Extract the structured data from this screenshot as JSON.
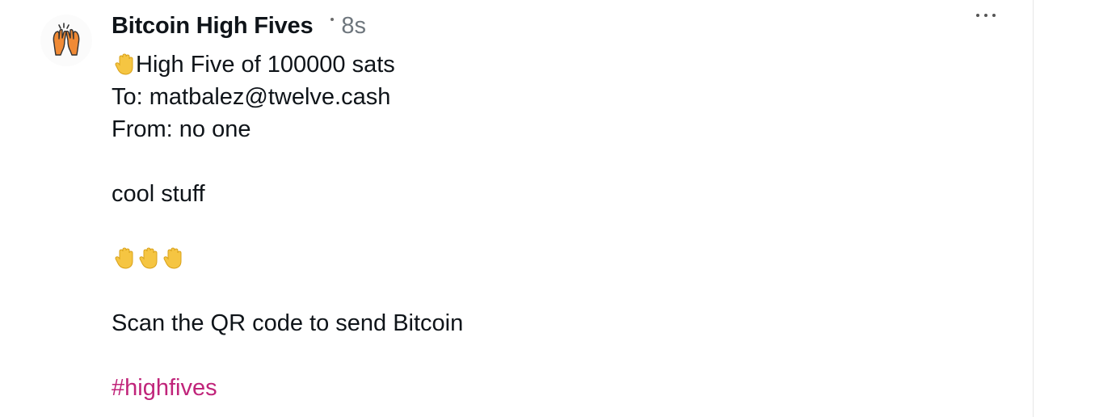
{
  "author": {
    "name": "Bitcoin High Fives",
    "timestamp": "8s",
    "avatar_icon": "high-five-hands-icon"
  },
  "post": {
    "line1": "High Five of 100000 sats",
    "line1_icon": "raised-hand-icon",
    "to": "To: matbalez@twelve.cash",
    "from": "From: no one",
    "message": "cool stuff",
    "hands_icons": [
      "raised-hand-icon",
      "raised-hand-icon",
      "raised-hand-icon"
    ],
    "cta": "Scan the QR code to send Bitcoin",
    "hashtag": "#highfives"
  },
  "menu": {
    "icon": "more-options-icon"
  },
  "colors": {
    "text": "#0f1419",
    "muted": "#6e767d",
    "hashtag": "#c0247a",
    "hand": "#f5c542",
    "avatar_hand": "#f08a35"
  }
}
